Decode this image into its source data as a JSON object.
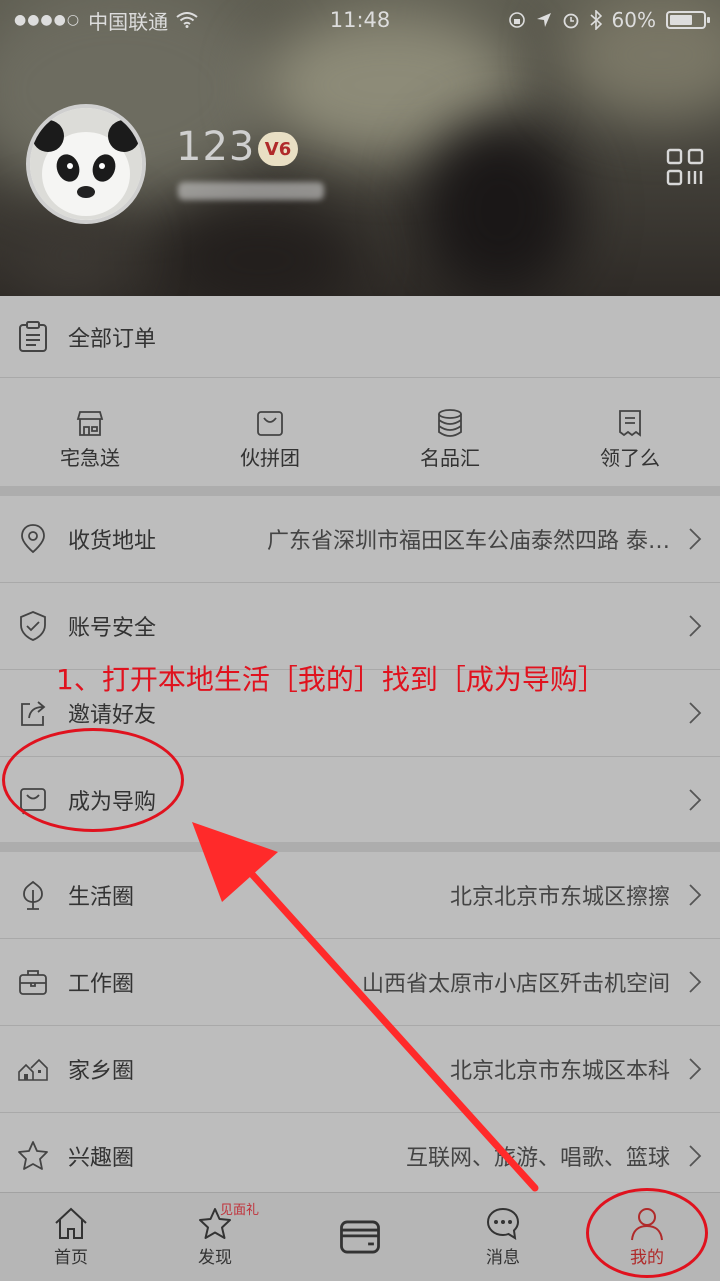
{
  "status_bar": {
    "carrier": "中国联通",
    "time": "11:48",
    "battery": "60%",
    "battery_level": 0.6
  },
  "profile": {
    "name": "123",
    "level_badge": "V6"
  },
  "orders": {
    "label": "全部订单"
  },
  "quick_links": [
    {
      "label": "宅急送",
      "icon": "store-icon"
    },
    {
      "label": "伙拼团",
      "icon": "bag-icon"
    },
    {
      "label": "名品汇",
      "icon": "coin-stack-icon"
    },
    {
      "label": "领了么",
      "icon": "receipt-icon"
    }
  ],
  "menu": [
    {
      "label": "收货地址",
      "value": "广东省深圳市福田区车公庙泰然四路 泰…",
      "icon": "location-pin-icon"
    },
    {
      "label": "账号安全",
      "value": "",
      "icon": "shield-icon"
    },
    {
      "label": "邀请好友",
      "value": "",
      "icon": "share-icon"
    },
    {
      "label": "成为导购",
      "value": "",
      "icon": "guide-bag-icon"
    }
  ],
  "circles": [
    {
      "label": "生活圈",
      "value": "北京北京市东城区擦擦",
      "icon": "flower-icon"
    },
    {
      "label": "工作圈",
      "value": "山西省太原市小店区歼击机空间",
      "icon": "briefcase-icon"
    },
    {
      "label": "家乡圈",
      "value": "北京北京市东城区本科",
      "icon": "houses-icon"
    },
    {
      "label": "兴趣圈",
      "value": "互联网、旅游、唱歌、篮球",
      "icon": "star-outline-icon"
    }
  ],
  "annotation": {
    "text": "1、打开本地生活［我的］找到［成为导购］",
    "color": "#e0121e"
  },
  "tabbar": [
    {
      "label": "首页",
      "icon": "home-icon"
    },
    {
      "label": "发现",
      "icon": "star-icon",
      "badge": "见面礼"
    },
    {
      "label": "",
      "icon": "wallet-icon"
    },
    {
      "label": "消息",
      "icon": "chat-icon"
    },
    {
      "label": "我的",
      "icon": "person-icon"
    }
  ]
}
